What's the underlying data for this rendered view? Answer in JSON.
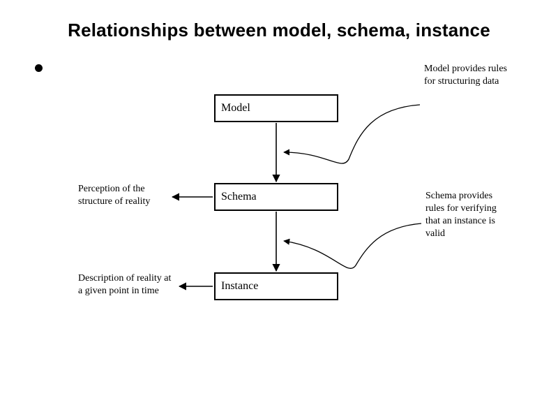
{
  "title": "Relationships between model, schema, instance",
  "boxes": {
    "model": "Model",
    "schema": "Schema",
    "instance": "Instance"
  },
  "annotations": {
    "model_rules": "Model provides rules for structuring data",
    "schema_perception": "Perception of the structure of reality",
    "schema_rules": "Schema provides rules for verifying that an instance is valid",
    "instance_desc": "Description of reality at a given point in time"
  }
}
